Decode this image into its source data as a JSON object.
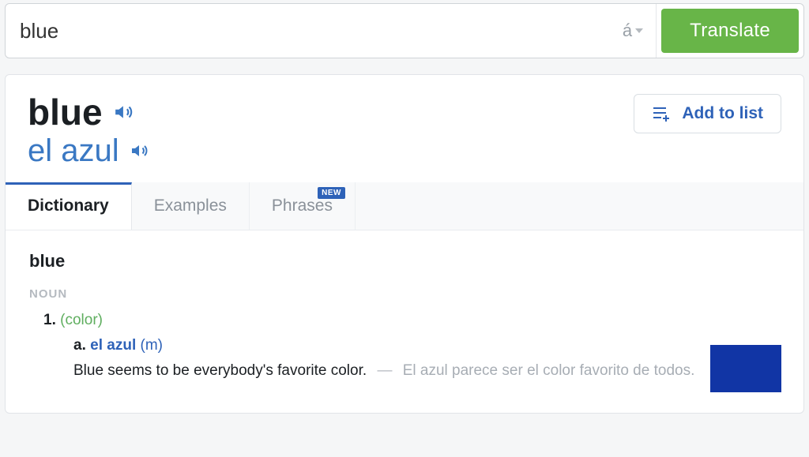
{
  "search": {
    "value": "blue",
    "accent_label": "á",
    "translate_label": "Translate"
  },
  "header": {
    "headword": "blue",
    "translation": "el azul",
    "add_to_list_label": "Add to list"
  },
  "tabs": {
    "dictionary": "Dictionary",
    "examples": "Examples",
    "phrases": "Phrases",
    "new_badge": "NEW"
  },
  "entry": {
    "headword": "blue",
    "pos": "NOUN",
    "sense_num": "1.",
    "sense_gloss": "(color)",
    "sub_letter": "a.",
    "sub_translation": "el azul",
    "sub_gender": "(m)",
    "example_en": "Blue seems to be everybody's favorite color.",
    "example_dash": "—",
    "example_es": "El azul parece ser el color favorito de todos.",
    "swatch_color": "#1135a5"
  }
}
